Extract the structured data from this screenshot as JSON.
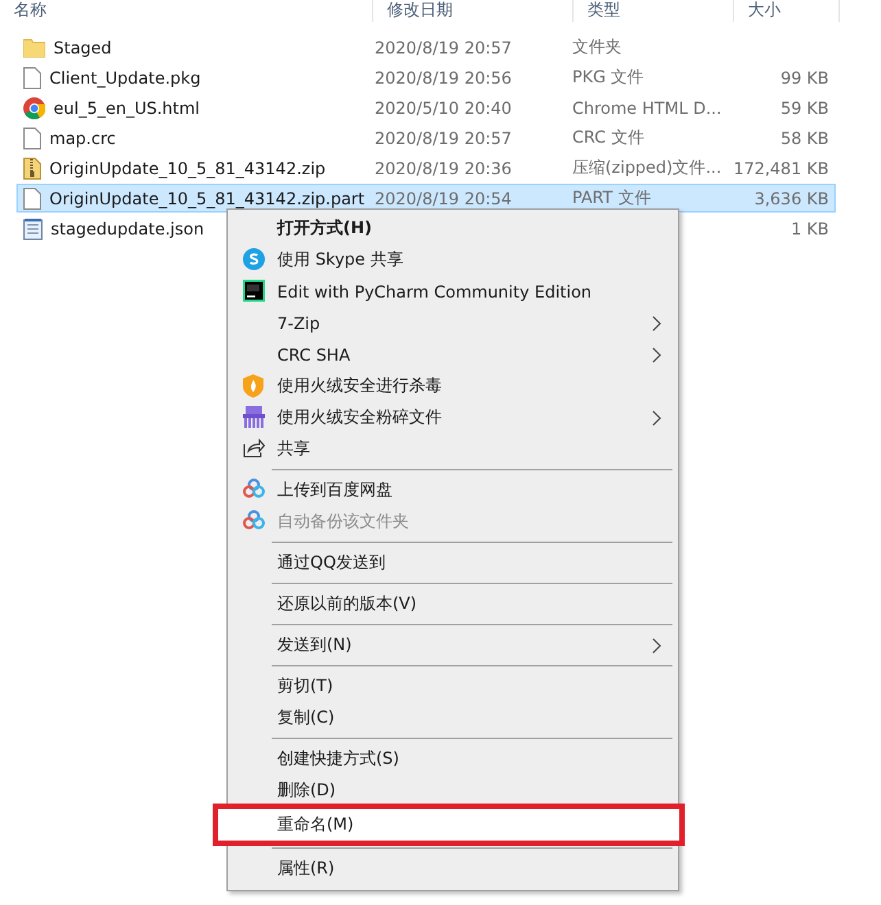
{
  "columns": [
    "名称",
    "修改日期",
    "类型",
    "大小"
  ],
  "files": [
    {
      "kind": "folder",
      "name": "Staged",
      "date": "2020/8/19 20:57",
      "type": "文件夹",
      "selected": false
    },
    {
      "kind": "file",
      "name": "Client_Update.pkg",
      "date": "2020/8/19 20:56",
      "type": "PKG 文件",
      "size": "99 KB",
      "selected": false
    },
    {
      "kind": "webpage",
      "name": "eul_5_en_US.html",
      "date": "2020/5/10 20:40",
      "type": "Chrome HTML D...",
      "size": "59 KB",
      "selected": false
    },
    {
      "kind": "file",
      "name": "map.crc",
      "date": "2020/8/19 20:57",
      "type": "CRC 文件",
      "size": "58 KB",
      "selected": false
    },
    {
      "kind": "archive",
      "name": "OriginUpdate_10_5_81_43142.zip",
      "date": "2020/8/19 20:36",
      "type": "压缩(zipped)文件...",
      "size": "172,481 KB",
      "selected": false
    },
    {
      "kind": "file",
      "name": "OriginUpdate_10_5_81_43142.zip.part",
      "date": "2020/8/19 20:54",
      "type": "PART 文件",
      "size": "3,636 KB",
      "selected": true
    },
    {
      "kind": "text",
      "name": "stagedupdate.json",
      "size": "1 KB",
      "selected": false
    }
  ],
  "context_menu": [
    {
      "kind": "default",
      "label": "打开方式(H)",
      "submenu": false,
      "disabled": false
    },
    {
      "kind": "item",
      "label": "使用 Skype 共享",
      "submenu": false,
      "disabled": false
    },
    {
      "kind": "item",
      "label": "Edit with PyCharm Community Edition",
      "submenu": false,
      "disabled": false
    },
    {
      "kind": "item",
      "label": "7-Zip",
      "submenu": true,
      "disabled": false
    },
    {
      "kind": "item",
      "label": "CRC SHA",
      "submenu": true,
      "disabled": false
    },
    {
      "kind": "item",
      "label": "使用火绒安全进行杀毒",
      "submenu": false,
      "disabled": false
    },
    {
      "kind": "item",
      "label": "使用火绒安全粉碎文件",
      "submenu": true,
      "disabled": false
    },
    {
      "kind": "item",
      "label": "共享",
      "submenu": false,
      "disabled": false
    },
    {
      "kind": "separator"
    },
    {
      "kind": "item",
      "label": "上传到百度网盘",
      "submenu": false,
      "disabled": false
    },
    {
      "kind": "item",
      "label": "自动备份该文件夹",
      "submenu": false,
      "disabled": true
    },
    {
      "kind": "separator"
    },
    {
      "kind": "item",
      "label": "通过QQ发送到",
      "submenu": false,
      "disabled": false
    },
    {
      "kind": "separator"
    },
    {
      "kind": "item",
      "label": "还原以前的版本(V)",
      "submenu": false,
      "disabled": false
    },
    {
      "kind": "separator"
    },
    {
      "kind": "item",
      "label": "发送到(N)",
      "submenu": true,
      "disabled": false
    },
    {
      "kind": "separator"
    },
    {
      "kind": "item",
      "label": "剪切(T)",
      "submenu": false,
      "disabled": false
    },
    {
      "kind": "item",
      "label": "复制(C)",
      "submenu": false,
      "disabled": false
    },
    {
      "kind": "separator"
    },
    {
      "kind": "item",
      "label": "创建快捷方式(S)",
      "submenu": false,
      "disabled": false
    },
    {
      "kind": "item",
      "label": "删除(D)",
      "submenu": false,
      "disabled": false
    },
    {
      "kind": "highlighted",
      "label": "重命名(M)",
      "submenu": false,
      "disabled": false
    },
    {
      "kind": "separator"
    },
    {
      "kind": "item",
      "label": "属性(R)",
      "submenu": false,
      "disabled": false
    }
  ]
}
